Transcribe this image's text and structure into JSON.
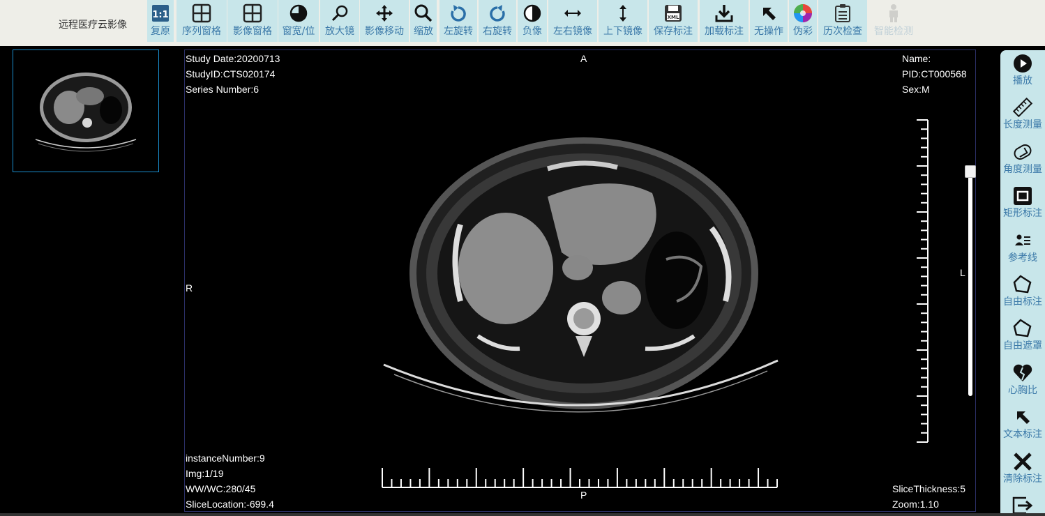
{
  "app_title": "远程医疗云影像",
  "toolbar": [
    {
      "name": "reset",
      "label": "复原",
      "icon": "one-to-one-icon"
    },
    {
      "name": "series-window",
      "label": "序列窗格",
      "icon": "grid-icon"
    },
    {
      "name": "image-window",
      "label": "影像窗格",
      "icon": "grid-icon"
    },
    {
      "name": "window-level",
      "label": "窗宽/位",
      "icon": "contrast-icon"
    },
    {
      "name": "magnifier",
      "label": "放大镜",
      "icon": "magnifier-icon"
    },
    {
      "name": "pan",
      "label": "影像移动",
      "icon": "move-icon"
    },
    {
      "name": "zoom",
      "label": "缩放",
      "icon": "zoom-icon"
    },
    {
      "name": "rotate-left",
      "label": "左旋转",
      "icon": "rotate-left-icon"
    },
    {
      "name": "rotate-right",
      "label": "右旋转",
      "icon": "rotate-right-icon"
    },
    {
      "name": "invert",
      "label": "负像",
      "icon": "invert-icon"
    },
    {
      "name": "flip-horizontal",
      "label": "左右镜像",
      "icon": "flip-horizontal-icon"
    },
    {
      "name": "flip-vertical",
      "label": "上下镜像",
      "icon": "flip-vertical-icon"
    },
    {
      "name": "save-annotation",
      "label": "保存标注",
      "icon": "save-xml-icon"
    },
    {
      "name": "load-annotation",
      "label": "加载标注",
      "icon": "download-icon"
    },
    {
      "name": "no-operation",
      "label": "无操作",
      "icon": "cursor-arrow-icon"
    },
    {
      "name": "pseudo-color",
      "label": "伪彩",
      "icon": "color-wheel-icon"
    },
    {
      "name": "history-exam",
      "label": "历次检查",
      "icon": "clipboard-icon"
    },
    {
      "name": "smart-detection",
      "label": "智能检测",
      "icon": "body-icon",
      "disabled": true
    }
  ],
  "right_tools": [
    {
      "name": "play",
      "label": "播放",
      "icon": "play-icon"
    },
    {
      "name": "length-measure",
      "label": "长度测量",
      "icon": "ruler-icon"
    },
    {
      "name": "angle-measure",
      "label": "角度测量",
      "icon": "angle-icon"
    },
    {
      "name": "rect-annotation",
      "label": "矩形标注",
      "icon": "rectangle-icon"
    },
    {
      "name": "reference-line",
      "label": "参考线",
      "icon": "reference-icon"
    },
    {
      "name": "free-annotation",
      "label": "自由标注",
      "icon": "polygon-icon"
    },
    {
      "name": "free-mask",
      "label": "自由遮罩",
      "icon": "polygon-icon"
    },
    {
      "name": "cardiothoracic-ratio",
      "label": "心胸比",
      "icon": "heart-icon"
    },
    {
      "name": "text-annotation",
      "label": "文本标注",
      "icon": "cursor-arrow-icon"
    },
    {
      "name": "clear-annotation",
      "label": "清除标注",
      "icon": "close-icon"
    },
    {
      "name": "exit",
      "label": "",
      "icon": "exit-icon"
    }
  ],
  "overlay": {
    "study_date": "Study Date:20200713",
    "study_id": "StudyID:CTS020174",
    "series_number": "Series Number:6",
    "orientation_top": "A",
    "orientation_left": "R",
    "orientation_right": "L",
    "orientation_bottom": "P",
    "name": "Name:",
    "pid": "PID:CT000568",
    "sex": "Sex:M",
    "instance_number": "instanceNumber:9",
    "img": "Img:1/19",
    "ww_wc": "WW/WC:280/45",
    "slice_location": "SliceLocation:-699.4",
    "slice_thickness": "SliceThickness:5",
    "zoom": "Zoom:1.10"
  },
  "series_scroll_position": 0.02
}
